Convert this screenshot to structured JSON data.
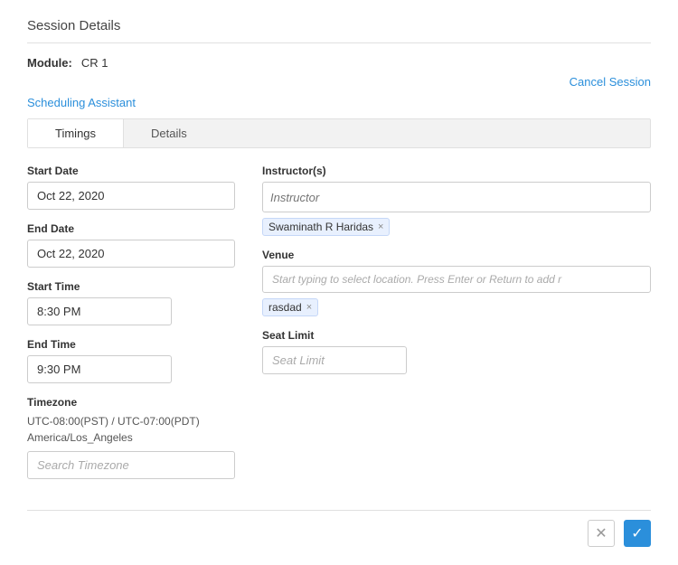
{
  "page": {
    "section_title": "Session Details",
    "module_label": "Module:",
    "module_value": "CR 1",
    "cancel_session_link": "Cancel Session",
    "scheduling_assistant_link": "Scheduling Assistant",
    "tabs": [
      {
        "id": "timings",
        "label": "Timings",
        "active": true
      },
      {
        "id": "details",
        "label": "Details",
        "active": false
      }
    ],
    "left_col": {
      "start_date_label": "Start Date",
      "start_date_value": "Oct 22, 2020",
      "end_date_label": "End Date",
      "end_date_value": "Oct 22, 2020",
      "start_time_label": "Start Time",
      "start_time_value": "8:30 PM",
      "end_time_label": "End Time",
      "end_time_value": "9:30 PM",
      "timezone_label": "Timezone",
      "timezone_value": "UTC-08:00(PST) / UTC-07:00(PDT) America/Los_Angeles",
      "timezone_search_placeholder": "Search Timezone"
    },
    "right_col": {
      "instructors_label": "Instructor(s)",
      "instructor_placeholder": "Instructor",
      "instructor_tags": [
        {
          "id": "tag-1",
          "name": "Swaminath R Haridas"
        }
      ],
      "venue_label": "Venue",
      "venue_placeholder": "Start typing to select location. Press Enter or Return to add r",
      "venue_tags": [
        {
          "id": "vtag-1",
          "name": "rasdad"
        }
      ],
      "seat_limit_label": "Seat Limit",
      "seat_limit_placeholder": "Seat Limit"
    },
    "footer": {
      "cancel_label": "✕",
      "confirm_label": "✓"
    }
  }
}
